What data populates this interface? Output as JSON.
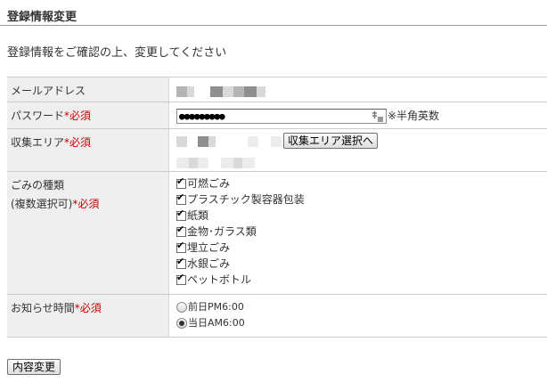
{
  "page": {
    "title": "登録情報変更",
    "intro": "登録情報をご確認の上、変更してください"
  },
  "form": {
    "required_mark": "*必須",
    "email": {
      "label": "メールアドレス"
    },
    "password": {
      "label": "パスワード",
      "value": "●●●●●●●●●",
      "hint": "※半角英数"
    },
    "area": {
      "label": "収集エリア",
      "button": "収集エリア選択へ"
    },
    "garbage": {
      "label": "ごみの種類",
      "sublabel": "(複数選択可)",
      "options": [
        {
          "label": "可燃ごみ",
          "checked": true
        },
        {
          "label": "プラスチック製容器包装",
          "checked": true
        },
        {
          "label": "紙類",
          "checked": true
        },
        {
          "label": "金物･ガラス類",
          "checked": true
        },
        {
          "label": "埋立ごみ",
          "checked": true
        },
        {
          "label": "水銀ごみ",
          "checked": true
        },
        {
          "label": "ペットボトル",
          "checked": true
        }
      ]
    },
    "notice": {
      "label": "お知らせ時間",
      "options": [
        {
          "label": "前日PM6:00",
          "selected": false
        },
        {
          "label": "当日AM6:00",
          "selected": true
        }
      ]
    },
    "submit": "内容変更"
  },
  "icons": {
    "ime": "ime-pad-icon"
  }
}
